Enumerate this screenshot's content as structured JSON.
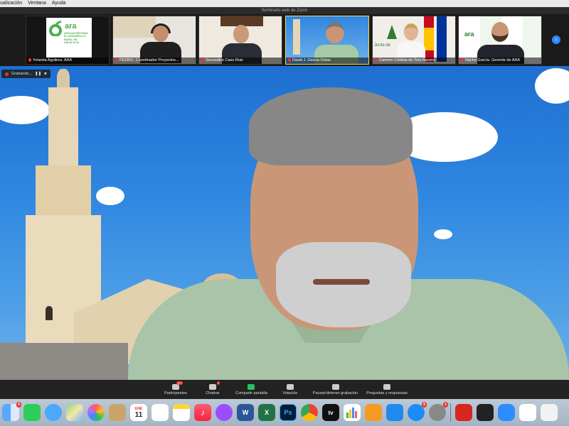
{
  "menubar": {
    "items": [
      "ualización",
      "Ventana",
      "Ayuda"
    ]
  },
  "window": {
    "title": "Seminario web de Zoom"
  },
  "participants": [
    {
      "name": "Yolanda Aguilera. ARA",
      "logo_text": "ara",
      "logo_caption": "ASOCIACIÓN PARA EL DESARROLLO RURAL DE ANDALUCÍA"
    },
    {
      "name": "PEDRO, Coordinador Proyectos...",
      "logo_text": "",
      "logo_caption": ""
    },
    {
      "name": "Secundino Caso Roiz",
      "logo_text": "",
      "logo_caption": ""
    },
    {
      "name": "David J. García Ostos",
      "logo_text": "",
      "logo_caption": ""
    },
    {
      "name": "Carmen Cristina de Toro Navero",
      "logo_text": "Junta de",
      "logo_caption": ""
    },
    {
      "name": "Nacho García. Gerente de ARA",
      "logo_text": "ara",
      "logo_caption": ""
    }
  ],
  "recording": {
    "label": "Grabando..."
  },
  "controls": [
    {
      "label": "Participantes",
      "count": "177",
      "icon": "participants-icon"
    },
    {
      "label": "Chatear",
      "count": "2",
      "icon": "chat-icon"
    },
    {
      "label": "Compartir pantalla",
      "count": "",
      "icon": "share-screen-icon"
    },
    {
      "label": "Votación",
      "count": "",
      "icon": "poll-icon"
    },
    {
      "label": "Pausar/detener grabación",
      "count": "",
      "icon": "pause-record-icon"
    },
    {
      "label": "Preguntas y respuestas",
      "count": "",
      "icon": "qa-icon"
    }
  ],
  "dock": {
    "finder_badge": "6",
    "calendar_month": "ENE",
    "calendar_day": "11",
    "appstore_badge": "5",
    "settings_badge": "1",
    "app_labels": {
      "word": "W",
      "excel": "X",
      "photoshop": "Ps",
      "tv": "tv"
    }
  },
  "colors": {
    "zoom_blue": "#2d8cff",
    "record_red": "#e33333",
    "share_green": "#22c55e"
  }
}
